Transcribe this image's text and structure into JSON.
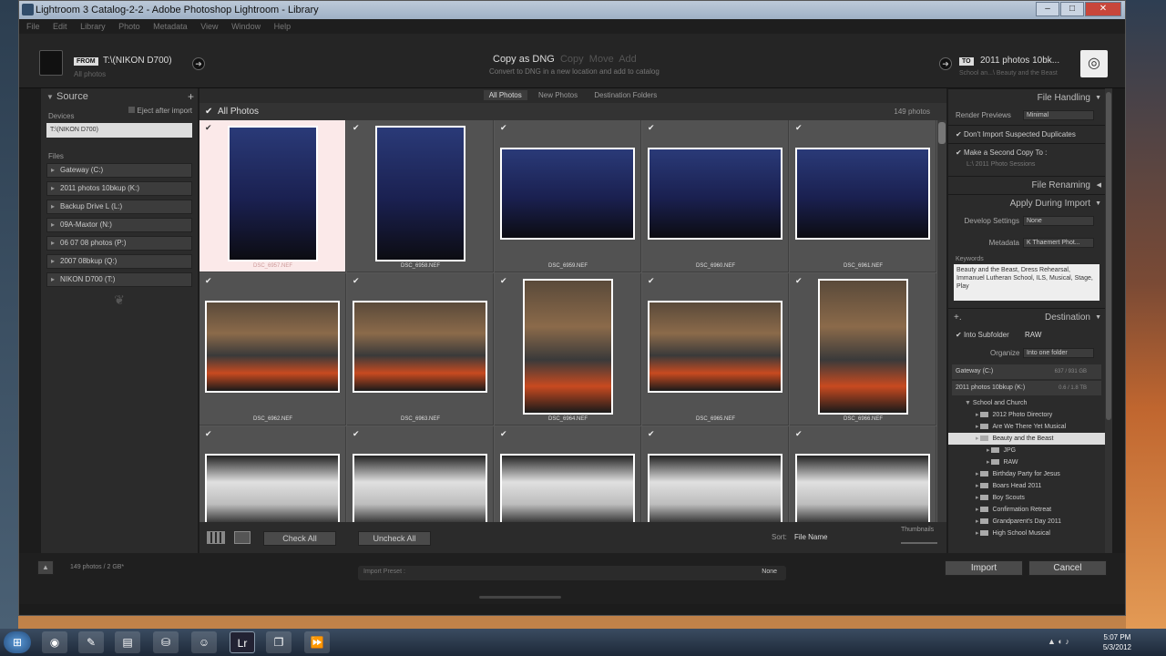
{
  "window": {
    "title": "Lightroom 3 Catalog-2-2 - Adobe Photoshop Lightroom - Library",
    "minimize": "–",
    "maximize": "□",
    "close": "✕"
  },
  "menu": [
    "File",
    "Edit",
    "Library",
    "Photo",
    "Metadata",
    "View",
    "Window",
    "Help"
  ],
  "top": {
    "from_tag": "FROM",
    "from_source": "T:\\(NIKON D700)",
    "from_sub": "All photos",
    "modes": [
      "Copy as DNG",
      "Copy",
      "Move",
      "Add"
    ],
    "active_mode": "Copy as DNG",
    "mode_desc": "Convert to DNG in a new location and add to catalog",
    "to_tag": "TO",
    "to_dest": "2011 photos 10bk...",
    "to_sub": "School an...\\ Beauty and the Beast",
    "arrow": "➜"
  },
  "source": {
    "title": "Source",
    "add": "+",
    "devices_label": "Devices",
    "eject_label": "Eject after import",
    "device_item": "T:\\(NIKON D700)",
    "files_label": "Files",
    "drives": [
      "Gateway (C:)",
      "2011 photos 10bkup (K:)",
      "Backup Drive L (L:)",
      "09A-Maxtor (N:)",
      "06 07 08 photos (P:)",
      "2007 08bkup (Q:)",
      "NIKON D700 (T:)"
    ]
  },
  "center": {
    "tabs": [
      "All Photos",
      "New Photos",
      "Destination Folders"
    ],
    "active_tab": "All Photos",
    "header_label": "All Photos",
    "count": "149 photos",
    "check_all": "Check All",
    "uncheck_all": "Uncheck All",
    "sort_label": "Sort:",
    "sort_value": "File Name",
    "thumbnails_label": "Thumbnails",
    "photos": [
      {
        "name": "DSC_6957.NEF",
        "shape": "port",
        "scene": "night"
      },
      {
        "name": "DSC_6958.NEF",
        "shape": "port",
        "scene": "night"
      },
      {
        "name": "DSC_6959.NEF",
        "shape": "land",
        "scene": "night"
      },
      {
        "name": "DSC_6960.NEF",
        "shape": "land",
        "scene": "night"
      },
      {
        "name": "DSC_6961.NEF",
        "shape": "land",
        "scene": "night"
      },
      {
        "name": "DSC_6962.NEF",
        "shape": "land",
        "scene": "stage"
      },
      {
        "name": "DSC_6963.NEF",
        "shape": "land",
        "scene": "stage"
      },
      {
        "name": "DSC_6964.NEF",
        "shape": "port",
        "scene": "stage"
      },
      {
        "name": "DSC_6965.NEF",
        "shape": "land",
        "scene": "stage"
      },
      {
        "name": "DSC_6966.NEF",
        "shape": "port",
        "scene": "stage"
      },
      {
        "name": "",
        "shape": "land",
        "scene": "castle"
      },
      {
        "name": "",
        "shape": "land",
        "scene": "castle"
      },
      {
        "name": "",
        "shape": "land",
        "scene": "castle"
      },
      {
        "name": "",
        "shape": "land",
        "scene": "castle"
      },
      {
        "name": "",
        "shape": "land",
        "scene": "castle"
      }
    ]
  },
  "right": {
    "file_handling": "File Handling",
    "render_label": "Render Previews",
    "render_value": "Minimal",
    "dont_import": "Don't Import Suspected Duplicates",
    "second_copy": "Make a Second Copy To :",
    "second_copy_path": "L:\\ 2011 Photo Sessions",
    "file_renaming": "File Renaming",
    "apply_during": "Apply During Import",
    "develop_label": "Develop Settings",
    "develop_value": "None",
    "metadata_label": "Metadata",
    "metadata_value": "K Thaemert Phot...",
    "keywords_label": "Keywords",
    "keywords_value": "Beauty and the Beast, Dress Rehearsal, Immanuel Lutheran School, ILS, Musical, Stage, Play",
    "destination": "Destination",
    "plus": "+.",
    "into_subfolder": "Into Subfolder",
    "subfolder_value": "RAW",
    "organize_label": "Organize",
    "organize_value": "Into one folder",
    "vol1": "Gateway (C:)",
    "vol1_size": "637 / 931 GB",
    "vol2": "2011 photos 10bkup (K:)",
    "vol2_size": "0.6 / 1.8 TB",
    "tree": [
      {
        "label": "School and Church",
        "indent": 0
      },
      {
        "label": "2012 Photo Directory",
        "indent": 1
      },
      {
        "label": "Are We There Yet Musical",
        "indent": 1
      },
      {
        "label": "Beauty and the Beast",
        "indent": 1,
        "hl": true
      },
      {
        "label": "JPG",
        "indent": 2
      },
      {
        "label": "RAW",
        "indent": 2
      },
      {
        "label": "Birthday Party for Jesus",
        "indent": 1
      },
      {
        "label": "Boars Head 2011",
        "indent": 1
      },
      {
        "label": "Boy Scouts",
        "indent": 1
      },
      {
        "label": "Confirmation Retreat",
        "indent": 1
      },
      {
        "label": "Grandparent's Day 2011",
        "indent": 1
      },
      {
        "label": "High School Musical",
        "indent": 1
      }
    ]
  },
  "bottom": {
    "summary": "149 photos / 2 GB*",
    "preset_label": "Import Preset :",
    "preset_value": "None",
    "import": "Import",
    "cancel": "Cancel"
  },
  "taskbar": {
    "time": "5:07 PM",
    "date": "5/3/2012"
  }
}
